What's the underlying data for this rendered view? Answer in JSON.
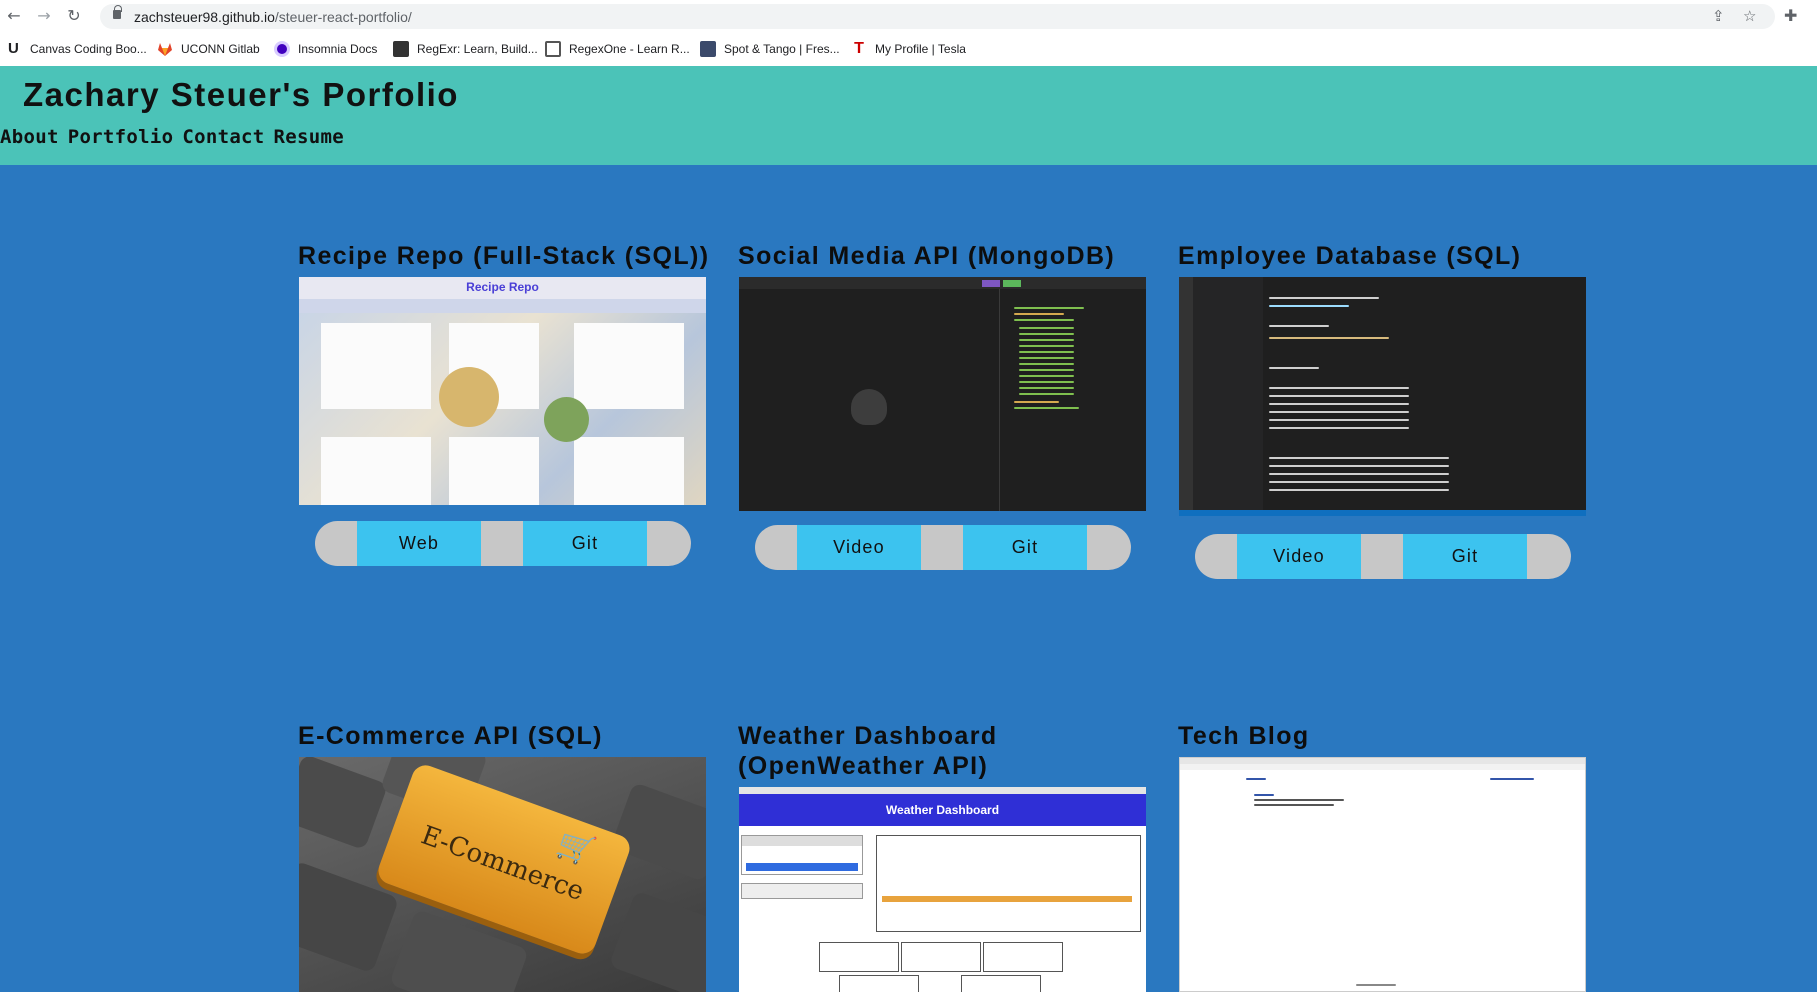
{
  "browser": {
    "url_host": "zachsteuer98.github.io",
    "url_path": "/steuer-react-portfolio/",
    "bookmarks": [
      {
        "label": "Canvas Coding Boo...",
        "icon_color": "#222222"
      },
      {
        "label": "UCONN Gitlab",
        "icon_color": "#e2432a"
      },
      {
        "label": "Insomnia Docs",
        "icon_color": "#4000bf"
      },
      {
        "label": "RegExr: Learn, Build...",
        "icon_color": "#333333"
      },
      {
        "label": "RegexOne - Learn R...",
        "icon_color": "#555555"
      },
      {
        "label": "Spot & Tango | Fres...",
        "icon_color": "#3b4a6b"
      },
      {
        "label": "My Profile | Tesla",
        "icon_color": "#cc0000"
      }
    ]
  },
  "header": {
    "title": "Zachary Steuer's Porfolio",
    "nav": [
      "About",
      "Portfolio",
      "Contact",
      "Resume"
    ],
    "bg_color": "#4bc3b8"
  },
  "page_bg": "#2a78c0",
  "projects": [
    {
      "title": "Recipe Repo (Full-Stack (SQL))",
      "buttons": [
        "Web",
        "Git"
      ],
      "preview_title": "Recipe Repo"
    },
    {
      "title": "Social Media API (MongoDB)",
      "buttons": [
        "Video",
        "Git"
      ]
    },
    {
      "title": "Employee Database (SQL)",
      "buttons": [
        "Video",
        "Git"
      ]
    },
    {
      "title": "E-Commerce API (SQL)",
      "preview_title": "E-Commerce"
    },
    {
      "title": "Weather Dashboard (OpenWeather API)",
      "preview_title": "Weather Dashboard"
    },
    {
      "title": "Tech Blog"
    }
  ]
}
